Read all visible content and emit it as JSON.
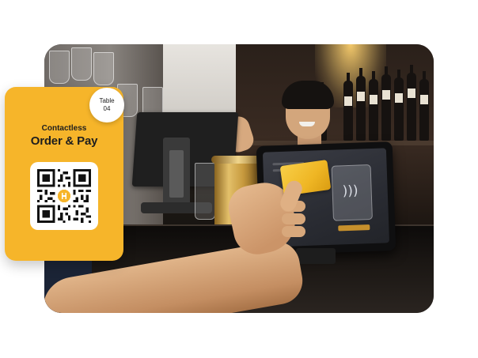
{
  "order_card": {
    "table_label": "Table",
    "table_number": "04",
    "subtitle": "Contactless",
    "title": "Order & Pay"
  },
  "colors": {
    "accent": "#f6b52a",
    "qr_center": "#f6b52a",
    "card": "#f2c13a"
  },
  "icons": {
    "qr": "qr-code-icon",
    "nfc": "contactless-payment-icon"
  }
}
